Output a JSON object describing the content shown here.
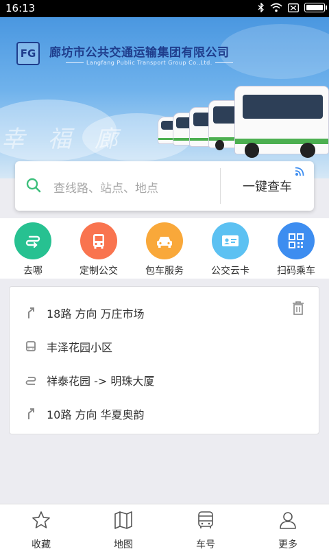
{
  "status_bar": {
    "time": "16:13",
    "icons": [
      "bluetooth-icon",
      "wifi-icon",
      "sim-icon",
      "battery-icon"
    ]
  },
  "banner": {
    "company_cn": "廊坊市公共交通运输集团有限公司",
    "company_en": "Langfang Public Transport Group Co.,Ltd.",
    "logo_text": "FG",
    "slogan": "幸福廊",
    "page_indicator": "1 ●"
  },
  "search": {
    "placeholder": "查线路、站点、地点",
    "query_button": "一键查车"
  },
  "actions": [
    {
      "label": "去哪",
      "icon": "route-icon",
      "color": "#27c191"
    },
    {
      "label": "定制公交",
      "icon": "bus-front-icon",
      "color": "#f9744f"
    },
    {
      "label": "包车服务",
      "icon": "car-icon",
      "color": "#f9a83a"
    },
    {
      "label": "公交云卡",
      "icon": "id-card-icon",
      "color": "#5cc1f2"
    },
    {
      "label": "扫码乘车",
      "icon": "qr-code-icon",
      "color": "#3d8df0"
    }
  ],
  "history": [
    {
      "text": "18路 方向 万庄市场",
      "icon": "route-turn-icon"
    },
    {
      "text": "丰泽花园小区",
      "icon": "bus-stop-icon"
    },
    {
      "text": "祥泰花园 -> 明珠大厦",
      "icon": "transfer-icon"
    },
    {
      "text": "10路 方向 华夏奥韵",
      "icon": "route-turn-icon"
    }
  ],
  "bottom_nav": [
    {
      "label": "收藏",
      "icon": "star-icon"
    },
    {
      "label": "地图",
      "icon": "map-icon"
    },
    {
      "label": "车号",
      "icon": "bus-icon"
    },
    {
      "label": "更多",
      "icon": "user-icon"
    }
  ],
  "colors": {
    "banner_blue": "#4a97e0",
    "company_navy": "#1f3d8c",
    "background": "#ececf1"
  }
}
